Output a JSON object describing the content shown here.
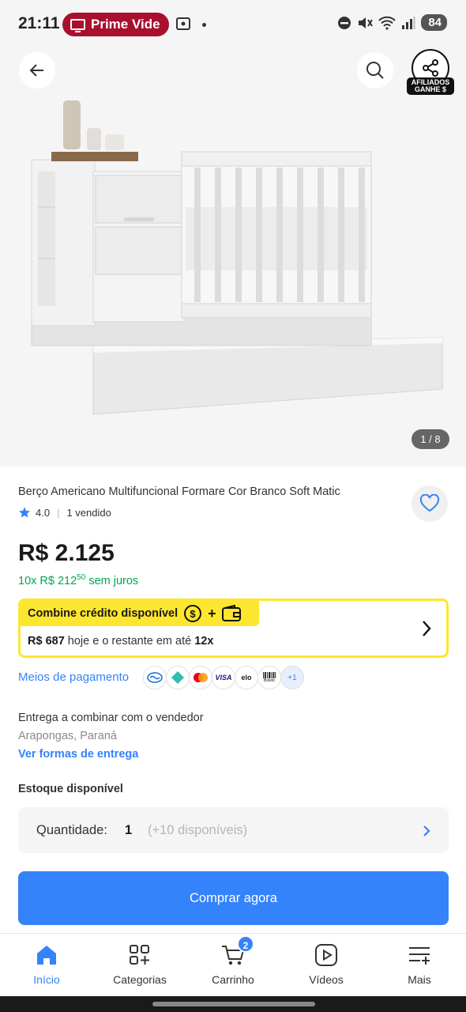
{
  "status_bar": {
    "time": "21:11",
    "pill_label": "Prime Vide",
    "battery": "84",
    "icons": [
      "screen-cast-icon",
      "dnd-icon",
      "mute-icon",
      "wifi-icon",
      "signal-icon"
    ]
  },
  "hero": {
    "image_counter": "1 / 8",
    "affiliate_badge": "AFILIADOS GANHE $",
    "icons": [
      "back-arrow-icon",
      "search-icon",
      "share-icon"
    ],
    "image_subject": "product-photo-crib"
  },
  "product": {
    "title": "Berço Americano Multifuncional Formare Cor Branco Soft Matic",
    "rating": "4.0",
    "sold": "1 vendido",
    "price": "R$ 2.125",
    "installments_prefix": "10x R$ 212",
    "installments_cents": "50",
    "installments_suffix": "sem juros"
  },
  "credit": {
    "banner": "Combine crédito disponível",
    "amount": "R$ 687",
    "text": "hoje e o restante em até",
    "installments": "12x"
  },
  "payment": {
    "link": "Meios de pagamento",
    "methods": [
      "mercadopago",
      "pix",
      "mastercard",
      "VISA",
      "elo",
      "Boleto"
    ],
    "more": "+1"
  },
  "delivery": {
    "title": "Entrega a combinar com o vendedor",
    "location": "Arapongas, Paraná",
    "link": "Ver formas de entrega"
  },
  "stock": {
    "title": "Estoque disponível",
    "quantity_label": "Quantidade:",
    "quantity_value": "1",
    "available": "(+10 disponíveis)"
  },
  "buy_button": "Comprar agora",
  "nav": {
    "items": [
      {
        "label": "Início",
        "icon": "home-icon"
      },
      {
        "label": "Categorias",
        "icon": "categories-icon"
      },
      {
        "label": "Carrinho",
        "icon": "cart-icon",
        "badge": "2"
      },
      {
        "label": "Vídeos",
        "icon": "video-icon"
      },
      {
        "label": "Mais",
        "icon": "more-icon"
      }
    ]
  },
  "colors": {
    "accent": "#3483fa",
    "green": "#00a650",
    "yellow": "#fde62f",
    "prime_pill": "#a8102e"
  }
}
